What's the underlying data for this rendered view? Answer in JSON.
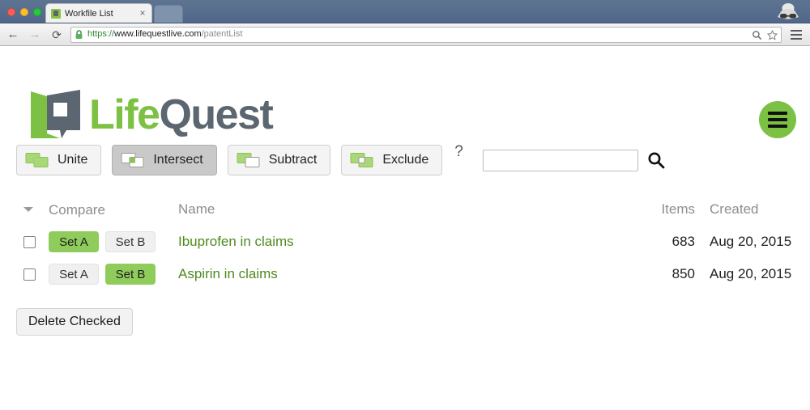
{
  "browser": {
    "tab": {
      "title": "Workfile List",
      "close_label": "×",
      "favicon": "lifequest-favicon-icon"
    },
    "nav": {
      "back_label": "←",
      "forward_label": "→",
      "reload_label": "⟳",
      "menu_label": "chrome-menu-icon"
    },
    "url": {
      "scheme": "https://",
      "host": "www.lifequestlive.com",
      "path": "/patentList"
    },
    "omni_icons": {
      "search": "search-icon",
      "bookmark": "star-icon"
    },
    "profile_icon": "incognito-icon"
  },
  "header": {
    "logo_life": "Life",
    "logo_quest": "Quest",
    "logo_mark": "lifequest-logo-mark",
    "menu_button": "hamburger-menu-icon"
  },
  "toolbar": {
    "operations": [
      {
        "label": "Unite",
        "icon": "unite-venn-icon",
        "active": false
      },
      {
        "label": "Intersect",
        "icon": "intersect-venn-icon",
        "active": true
      },
      {
        "label": "Subtract",
        "icon": "subtract-venn-icon",
        "active": false
      },
      {
        "label": "Exclude",
        "icon": "exclude-venn-icon",
        "active": false
      }
    ],
    "help_label": "?",
    "search": {
      "value": "",
      "placeholder": "",
      "icon": "search-icon"
    }
  },
  "table": {
    "headers": {
      "sort": "sort-caret-icon",
      "compare": "Compare",
      "name": "Name",
      "items": "Items",
      "created": "Created"
    },
    "set_a_label": "Set A",
    "set_b_label": "Set B",
    "rows": [
      {
        "checked": false,
        "set_a_active": true,
        "set_b_active": false,
        "name": "Ibuprofen in claims",
        "items": "683",
        "created": "Aug 20, 2015"
      },
      {
        "checked": false,
        "set_a_active": false,
        "set_b_active": true,
        "name": "Aspirin in claims",
        "items": "850",
        "created": "Aug 20, 2015"
      }
    ]
  },
  "actions": {
    "delete_label": "Delete Checked"
  },
  "colors": {
    "brand_green": "#7CC143",
    "set_active_green": "#90CC5C",
    "link_green": "#4E8A1E",
    "logo_gray": "#5b6670"
  }
}
